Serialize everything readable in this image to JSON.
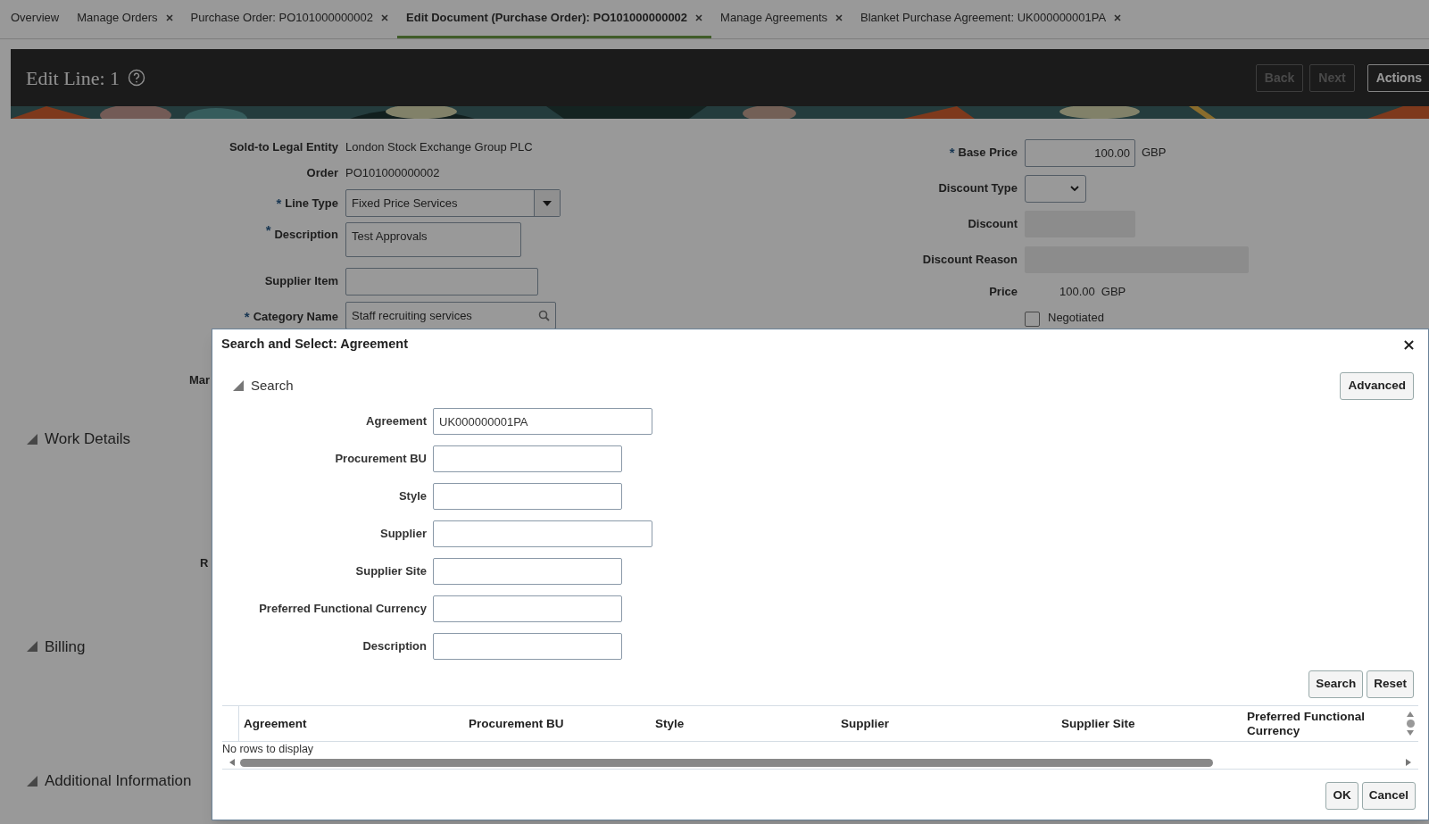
{
  "tabs": [
    {
      "label": "Overview",
      "selected": false
    },
    {
      "label": "Manage Orders",
      "closable": true,
      "selected": false
    },
    {
      "label": "Purchase Order: PO101000000002",
      "closable": true,
      "selected": false
    },
    {
      "label": "Edit Document (Purchase Order): PO101000000002",
      "closable": true,
      "selected": true
    },
    {
      "label": "Manage Agreements",
      "closable": true,
      "selected": false
    },
    {
      "label": "Blanket Purchase Agreement: UK000000001PA",
      "closable": true,
      "selected": false
    }
  ],
  "header": {
    "title": "Edit Line: 1",
    "buttons": [
      {
        "label": "Back",
        "disabled": true
      },
      {
        "label": "Next",
        "disabled": true
      },
      {
        "label": "Actions",
        "disabled": false
      }
    ]
  },
  "line_form": [
    {
      "label": "Sold-to Legal Entity",
      "kind": "text",
      "value": "London Stock Exchange Group PLC"
    },
    {
      "label": "Order",
      "kind": "text",
      "value": "PO101000000002"
    },
    {
      "label": "Line Type",
      "required_mark": "*",
      "kind": "select",
      "value": "Fixed Price Services"
    },
    {
      "label": "Description",
      "required_mark": "*",
      "kind": "textarea",
      "value": "Test Approvals"
    },
    {
      "label": "Supplier Item",
      "kind": "input"
    },
    {
      "label": "Category Name",
      "required_mark": "*",
      "kind": "search",
      "value": "Staff recruiting services"
    }
  ],
  "price_form": [
    {
      "label": "Base Price",
      "required_mark": "*",
      "kind": "input",
      "value": "100.00",
      "unit": "GBP"
    },
    {
      "label": "Discount Type",
      "kind": "select"
    },
    {
      "label": "Discount",
      "kind": "disabled"
    },
    {
      "label": "Discount Reason",
      "kind": "disabled_wide"
    },
    {
      "label": "Price",
      "kind": "text",
      "value": "100.00",
      "unit": "GBP"
    },
    {
      "label": "Negotiated",
      "kind": "checkbox",
      "checked": false
    }
  ],
  "cut_labels": [
    "Mar",
    "R"
  ],
  "sections": [
    {
      "label": "Work Details",
      "expanded": true
    },
    {
      "label": "Billing",
      "expanded": true
    },
    {
      "label": "Additional Information",
      "expanded": true
    }
  ],
  "dialog": {
    "title": "Search and Select: Agreement",
    "search_section": {
      "label": "Search",
      "expanded": true
    },
    "advanced_button": "Advanced",
    "fields": [
      {
        "label": "Agreement",
        "value": "UK000000001PA",
        "wide": true
      },
      {
        "label": "Procurement BU",
        "wide": false
      },
      {
        "label": "Style",
        "wide": false
      },
      {
        "label": "Supplier",
        "wide": true
      },
      {
        "label": "Supplier Site",
        "wide": false
      },
      {
        "label": "Preferred Functional Currency",
        "wide": false
      },
      {
        "label": "Description",
        "wide": false
      }
    ],
    "search_buttons": [
      "Search",
      "Reset"
    ],
    "table": {
      "columns": [
        "Agreement",
        "Procurement BU",
        "Style",
        "Supplier",
        "Supplier Site",
        "Preferred Functional Currency"
      ],
      "empty_text": "No rows to display"
    },
    "footer_buttons": [
      "OK",
      "Cancel"
    ]
  }
}
